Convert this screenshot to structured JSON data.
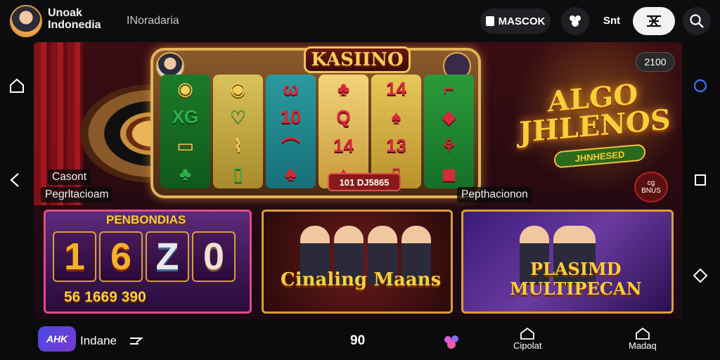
{
  "topbar": {
    "brand_line1": "Unoak",
    "brand_line2": "Indonedia",
    "subtitle": "INoradaria",
    "login_label": "MASCOK",
    "text_button": "Snt",
    "icons": [
      "gift-icon",
      "menu-icon",
      "search-icon"
    ]
  },
  "side_nav": {
    "left": [
      "home-icon",
      "back-icon"
    ],
    "right": [
      "circle-icon",
      "square-icon",
      "diamond-icon"
    ]
  },
  "hero": {
    "slot_title": "KASIINO",
    "slot_counter": "101 DJ5865",
    "reels": [
      [
        "◉",
        "XG",
        "▭",
        "♣"
      ],
      [
        "◉",
        "♡",
        "⌇",
        "▯"
      ],
      [
        "ω",
        "10",
        "⌒",
        "♣"
      ],
      [
        "♣",
        "Q",
        "14",
        "♦"
      ],
      [
        "14",
        "♠",
        "13",
        "▯"
      ],
      [
        "⌐",
        "◆",
        "⚘",
        "◼"
      ]
    ],
    "caption_left_1": "Casont",
    "caption_left_2": "Pegrltacioam",
    "caption_right": "Pepthacionon",
    "promo_title": "ALGO JHLENOS",
    "promo_sub": "JHNHESED",
    "badge_top": "2100",
    "badge_bottom_1": "cg",
    "badge_bottom_2": "BNUS"
  },
  "cards": [
    {
      "head": "PENBONDIAS",
      "digits": [
        "1",
        "6",
        "Z",
        "0"
      ],
      "foot": "56  1669  390"
    },
    {
      "title": "Cinaling Maans"
    },
    {
      "title_1": "PLASIMD",
      "title_2": "MULTIPECAN"
    }
  ],
  "bottombar": {
    "app_icon_text": "AHK",
    "app_label": "Indane",
    "center_number": "90",
    "nav_items": [
      {
        "label": "Cipolat",
        "icon": "home-outline-icon"
      },
      {
        "label": "Madaq",
        "icon": "home-outline-icon"
      }
    ]
  }
}
